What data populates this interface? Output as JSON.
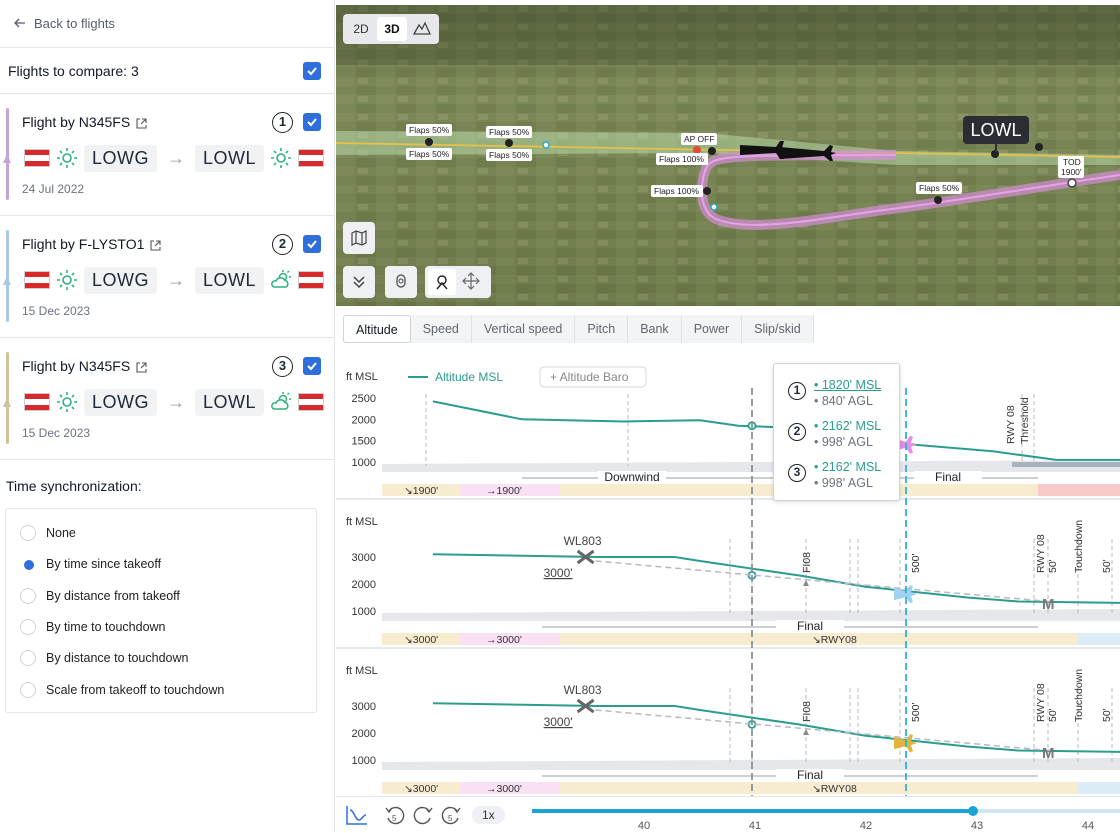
{
  "sidebar": {
    "back_label": "Back to flights",
    "compare_label": "Flights to compare: 3",
    "flights": [
      {
        "name": "Flight by N345FS",
        "number": "1",
        "from": "LOWG",
        "to": "LOWL",
        "date": "24 Jul 2022",
        "color": "#c7a4d6",
        "wx_from": "sun",
        "wx_to": "sun"
      },
      {
        "name": "Flight by F-LYSTO1",
        "number": "2",
        "from": "LOWG",
        "to": "LOWL",
        "date": "15 Dec 2023",
        "color": "#a8c8e6",
        "wx_from": "sun",
        "wx_to": "partly-cloudy"
      },
      {
        "name": "Flight by N345FS",
        "number": "3",
        "from": "LOWG",
        "to": "LOWL",
        "date": "15 Dec 2023",
        "color": "#cfc39a",
        "wx_from": "sun",
        "wx_to": "partly-cloudy"
      }
    ],
    "time_sync_title": "Time synchronization:",
    "time_sync_options": [
      "None",
      "By time since takeoff",
      "By distance from takeoff",
      "By time to touchdown",
      "By distance to touchdown",
      "Scale from takeoff to touchdown"
    ],
    "time_sync_selected": "By time since takeoff"
  },
  "map": {
    "view_2d": "2D",
    "view_3d": "3D",
    "airport_label": "LOWL",
    "labels": {
      "flaps50_a": "Flaps 50%",
      "flaps50_b": "Flaps 50%",
      "flaps50_c": "Flaps 50%",
      "flaps50_d": "Flaps 50%",
      "ap_off": "AP OFF",
      "flaps100_a": "Flaps 100%",
      "flaps100_b": "Flaps 100%",
      "flaps50_e": "Flaps 50%",
      "tod": "TOD",
      "tod_alt": "1900'"
    }
  },
  "chart_tabs": [
    "Altitude",
    "Speed",
    "Vertical speed",
    "Pitch",
    "Bank",
    "Power",
    "Slip/skid"
  ],
  "chart_tabs_active": "Altitude",
  "chart_data": [
    {
      "type": "line",
      "ylabel": "ft MSL",
      "yticks": [
        1000,
        1500,
        2000,
        2500
      ],
      "legend": [
        "Altitude MSL",
        "Altitude Baro"
      ],
      "series": [
        {
          "name": "Altitude MSL",
          "x": [
            38.9,
            39.6,
            40.4,
            41.0,
            41.3,
            41.9,
            42.3,
            42.7,
            43.3,
            43.8,
            44.3
          ],
          "y": [
            2420,
            2000,
            1950,
            1980,
            1850,
            1780,
            1600,
            1400,
            1250,
            1050,
            1050
          ]
        }
      ],
      "segments": [
        "Downwind",
        "Final"
      ],
      "phase_labels": [
        "↘1900'",
        "→1900'",
        "↘RWY08"
      ],
      "annotations": [
        "RWY 08",
        "Threshold",
        "500'"
      ]
    },
    {
      "type": "line",
      "ylabel": "ft MSL",
      "yticks": [
        1000,
        2000,
        3000
      ],
      "series": [
        {
          "name": "Altitude",
          "x": [
            38.9,
            40.2,
            40.8,
            41.0,
            41.8,
            42.3,
            42.7,
            43.1,
            43.5,
            44.3
          ],
          "y": [
            3100,
            3000,
            3000,
            2850,
            2300,
            1900,
            1700,
            1500,
            1350,
            1300
          ]
        }
      ],
      "waypoint": "WL803",
      "waypoint_alt": "3000'",
      "segments": [
        "Final"
      ],
      "phase_labels": [
        "↘3000'",
        "→3000'",
        "↘RWY08"
      ],
      "annotations": [
        "FI08",
        "500'",
        "RWY 08",
        "50'",
        "Touchdown",
        "50'",
        "M"
      ]
    },
    {
      "type": "line",
      "ylabel": "ft MSL",
      "yticks": [
        1000,
        2000,
        3000
      ],
      "series": [
        {
          "name": "Altitude",
          "x": [
            38.9,
            40.2,
            40.8,
            41.0,
            41.8,
            42.3,
            42.7,
            43.1,
            43.5,
            44.3
          ],
          "y": [
            3100,
            3000,
            3000,
            2850,
            2300,
            1900,
            1700,
            1500,
            1350,
            1300
          ]
        }
      ],
      "waypoint": "WL803",
      "waypoint_alt": "3000'",
      "segments": [
        "Final"
      ],
      "phase_labels": [
        "↘3000'",
        "→3000'",
        "↘RWY08"
      ],
      "annotations": [
        "FI08",
        "500'",
        "RWY 08",
        "50'",
        "Touchdown",
        "50'",
        "M"
      ]
    }
  ],
  "tooltip": [
    {
      "num": "1",
      "msl": "1820' MSL",
      "agl": "840' AGL"
    },
    {
      "num": "2",
      "msl": "2162' MSL",
      "agl": "998' AGL"
    },
    {
      "num": "3",
      "msl": "2162' MSL",
      "agl": "998' AGL"
    }
  ],
  "timeline": {
    "speed": "1x",
    "ticks": [
      "40",
      "41",
      "42",
      "43",
      "44"
    ],
    "progress": 0.75
  }
}
